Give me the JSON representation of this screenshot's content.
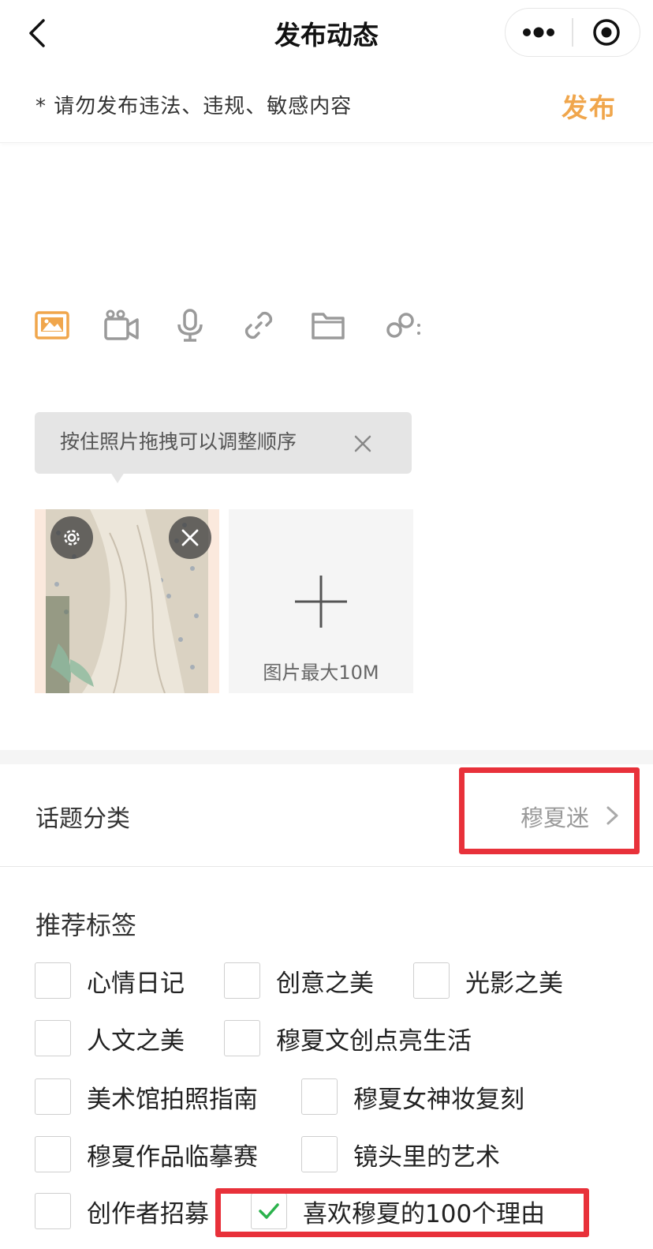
{
  "nav": {
    "title": "发布动态"
  },
  "notice": {
    "text": "* 请勿发布违法、违规、敏感内容",
    "publish_label": "发布"
  },
  "toolbar": {
    "icons": [
      "image-icon",
      "video-icon",
      "microphone-icon",
      "link-icon",
      "folder-icon",
      "mention-icon"
    ],
    "active_color": "#f0a64c",
    "inactive_color": "#9a9a9a"
  },
  "tooltip": {
    "text": "按住照片拖拽可以调整顺序"
  },
  "upload": {
    "add_label": "图片最大10M"
  },
  "topic": {
    "label": "话题分类",
    "value": "穆夏迷"
  },
  "recommend": {
    "title": "推荐标签",
    "tags": [
      {
        "label": "心情日记",
        "checked": false
      },
      {
        "label": "创意之美",
        "checked": false
      },
      {
        "label": "光影之美",
        "checked": false
      },
      {
        "label": "人文之美",
        "checked": false
      },
      {
        "label": "穆夏文创点亮生活",
        "checked": false
      },
      {
        "label": "美术馆拍照指南",
        "checked": false
      },
      {
        "label": "穆夏女神妆复刻",
        "checked": false
      },
      {
        "label": "穆夏作品临摹赛",
        "checked": false
      },
      {
        "label": "镜头里的艺术",
        "checked": false
      },
      {
        "label": "创作者招募",
        "checked": false
      },
      {
        "label": "喜欢穆夏的100个理由",
        "checked": true
      }
    ]
  },
  "colors": {
    "accent": "#f0a64c",
    "highlight_box": "#e8313a",
    "check": "#2bb24c"
  }
}
